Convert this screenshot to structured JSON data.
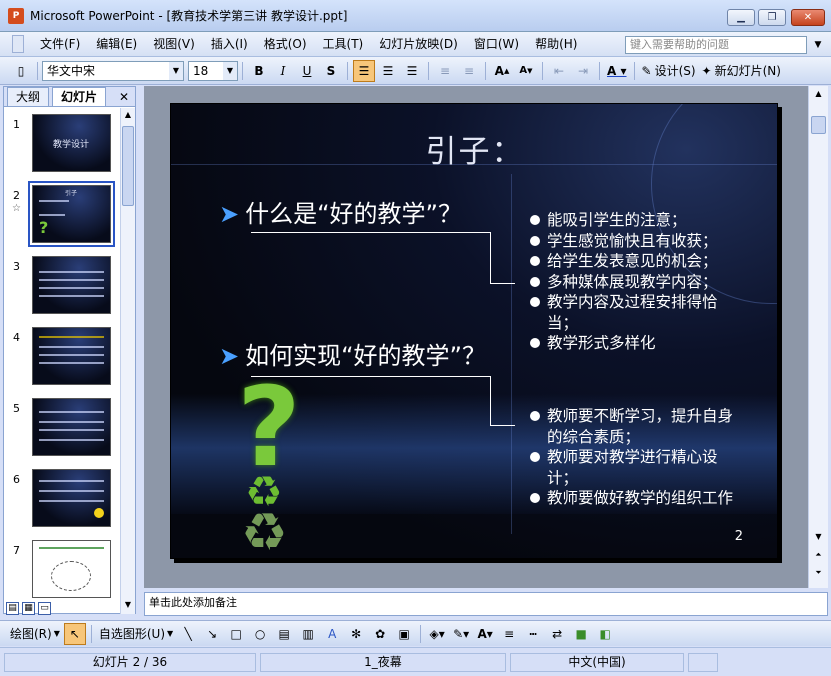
{
  "window": {
    "title": "Microsoft PowerPoint - [教育技术学第三讲 教学设计.ppt]",
    "icon_text": "P"
  },
  "menu": {
    "items": [
      "文件(F)",
      "编辑(E)",
      "视图(V)",
      "插入(I)",
      "格式(O)",
      "工具(T)",
      "幻灯片放映(D)",
      "窗口(W)",
      "帮助(H)"
    ],
    "help_placeholder": "键入需要帮助的问题"
  },
  "toolbar": {
    "font_name": "华文中宋",
    "font_size": "18",
    "design_label": "设计(S)",
    "new_slide_label": "新幻灯片(N)"
  },
  "panel": {
    "tab_outline": "大纲",
    "tab_slides": "幻灯片"
  },
  "thumbnails": [
    {
      "num": "1",
      "title": "教学设计"
    },
    {
      "num": "2",
      "title": "引子"
    },
    {
      "num": "3",
      "title": ""
    },
    {
      "num": "4",
      "title": ""
    },
    {
      "num": "5",
      "title": ""
    },
    {
      "num": "6",
      "title": ""
    },
    {
      "num": "7",
      "title": ""
    }
  ],
  "slide": {
    "title": "引子：",
    "q1": "什么是“好的教学”？",
    "q2": "如何实现“好的教学”？",
    "bullets1": [
      "能吸引学生的注意；",
      "学生感觉愉快且有收获；",
      "给学生发表意见的机会；",
      "多种媒体展现教学内容；",
      "教学内容及过程安排得恰当；",
      "教学形式多样化"
    ],
    "bullets2": [
      "教师要不断学习，提升自身的综合素质；",
      "教师要对教学进行精心设计；",
      "教师要做好教学的组织工作"
    ],
    "page": "2"
  },
  "notes": {
    "placeholder": "单击此处添加备注"
  },
  "drawbar": {
    "draw_label": "绘图(R)",
    "autoshape_label": "自选图形(U)"
  },
  "status": {
    "slide_info": "幻灯片 2 / 36",
    "design": "1_夜幕",
    "language": "中文(中国)"
  }
}
